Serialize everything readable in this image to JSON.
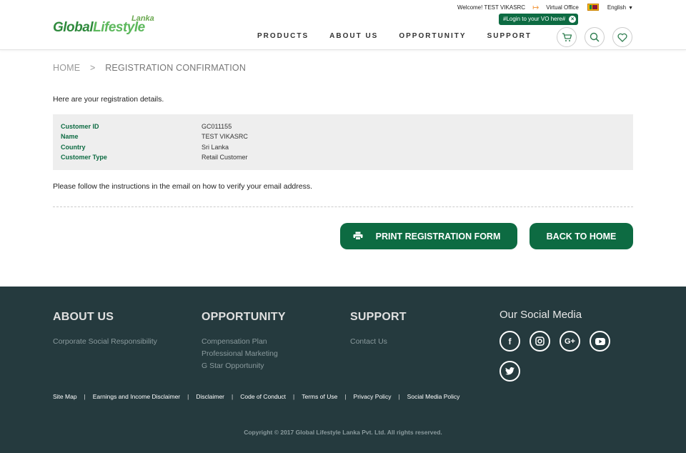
{
  "header": {
    "logo_small": "Lanka",
    "logo_word_a": "Global",
    "logo_word_b": "Lifestyle",
    "welcome": "Welcome! TEST VIKASRC",
    "virtual_office": "Virtual Office",
    "language": "English",
    "vo_tooltip": "#Login to your VO here#",
    "tooltip_close": "×",
    "nav": [
      "PRODUCTS",
      "ABOUT US",
      "OPPORTUNITY",
      "SUPPORT"
    ]
  },
  "breadcrumb": {
    "home": "HOME",
    "separator": ">",
    "current": "REGISTRATION CONFIRMATION"
  },
  "main": {
    "intro": "Here are your registration details.",
    "details": [
      {
        "label": "Customer ID",
        "value": "GC011155"
      },
      {
        "label": "Name",
        "value": "TEST VIKASRC"
      },
      {
        "label": "Country",
        "value": "Sri Lanka"
      },
      {
        "label": "Customer Type",
        "value": "Retail Customer"
      }
    ],
    "note": "Please follow the instructions in the email on how to verify your email address.",
    "print_button": "PRINT REGISTRATION FORM",
    "home_button": "BACK TO HOME"
  },
  "footer": {
    "about": {
      "title": "ABOUT US",
      "links": [
        "Corporate Social Responsibility"
      ]
    },
    "opportunity": {
      "title": "OPPORTUNITY",
      "links": [
        "Compensation Plan",
        "Professional Marketing",
        "G Star Opportunity"
      ]
    },
    "support": {
      "title": "SUPPORT",
      "links": [
        "Contact Us"
      ]
    },
    "social_title": "Our Social Media",
    "social_icons": [
      "facebook-icon",
      "instagram-icon",
      "google-plus-icon",
      "youtube-icon",
      "twitter-icon"
    ],
    "legal": [
      "Site Map",
      "Earnings and Income Disclaimer",
      "Disclaimer",
      "Code of Conduct",
      "Terms of Use",
      "Privacy Policy",
      "Social Media Policy"
    ],
    "legal_separator": "|",
    "copyright": "Copyright © 2017 Global Lifestyle Lanka Pvt. Ltd. All rights reserved."
  },
  "colors": {
    "brand_green": "#0d6b42",
    "footer_bg": "#253a3e",
    "details_bg": "#eeeeee"
  }
}
